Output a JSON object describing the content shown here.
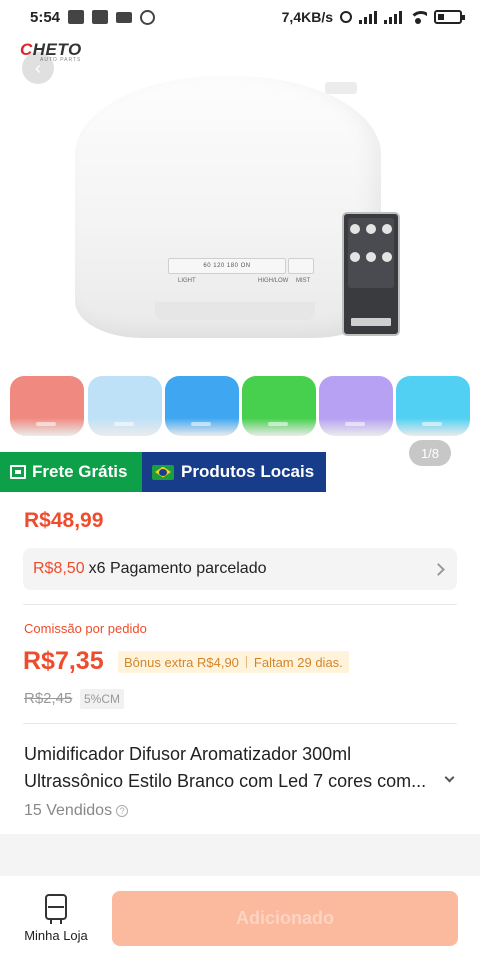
{
  "status_bar": {
    "time": "5:54",
    "net_speed": "7,4KB/s",
    "icons": [
      "notification-icon",
      "notification-icon",
      "video-icon",
      "whatsapp-icon",
      "alarm-icon",
      "signal-icon",
      "signal-icon",
      "wifi-icon",
      "battery-icon"
    ]
  },
  "gallery": {
    "logo_text": "HETO",
    "logo_letter": "C",
    "logo_sub": "AUTO PARTS",
    "counter": "1/8",
    "panel_text": "60 120 180 ON",
    "panel_labels": [
      "LIGHT",
      "HIGH/LOW",
      "MIST"
    ],
    "swatch_colors": [
      "#f08a80",
      "#bfe1f8",
      "#3fa7f1",
      "#46d04e",
      "#b6a1f3",
      "#52d0f3"
    ]
  },
  "badges": {
    "frete": "Frete Grátis",
    "locais": "Produtos Locais",
    "frete_color": "#0e9f49",
    "locais_color": "#173c89"
  },
  "price": {
    "main": "R$48,99",
    "installment_value": "R$8,50",
    "installment_text": "x6 Pagamento parcelado",
    "accent_color": "#ee4d2d"
  },
  "commission": {
    "label": "Comissão por pedido",
    "value": "R$7,35",
    "bonus": "Bônus extra R$4,90",
    "remaining": "Faltam 29 dias.",
    "old_value": "R$2,45",
    "percent": "5%CM"
  },
  "product": {
    "title_line1": "Umidificador Difusor Aromatizador 300ml",
    "title_line2": "Ultrassônico Estilo Branco com Led 7 cores com...",
    "sold": "15 Vendidos"
  },
  "bottom_bar": {
    "store_label": "Minha Loja",
    "add_label": "Adicionado"
  }
}
